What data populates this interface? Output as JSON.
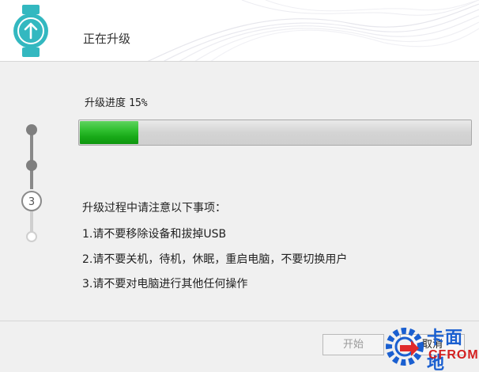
{
  "window": {
    "title": "正在升级",
    "accent_color": "#33b8c0"
  },
  "progress": {
    "label": "升级进度",
    "percent_text": "15%",
    "value": 0.15,
    "fill_color": "#17a817"
  },
  "stepper": {
    "current_step": "3",
    "total_steps": 4
  },
  "notes": {
    "title": "升级过程中请注意以下事项：",
    "items": [
      "1.请不要移除设备和拔掉USB",
      "2.请不要关机，待机，休眠，重启电脑，不要切换用户",
      "3.请不要对电脑进行其他任何操作"
    ]
  },
  "buttons": {
    "start": "开始",
    "cancel": "取消"
  },
  "watermark": {
    "cn": "卡面地",
    "en": "CFROM"
  }
}
